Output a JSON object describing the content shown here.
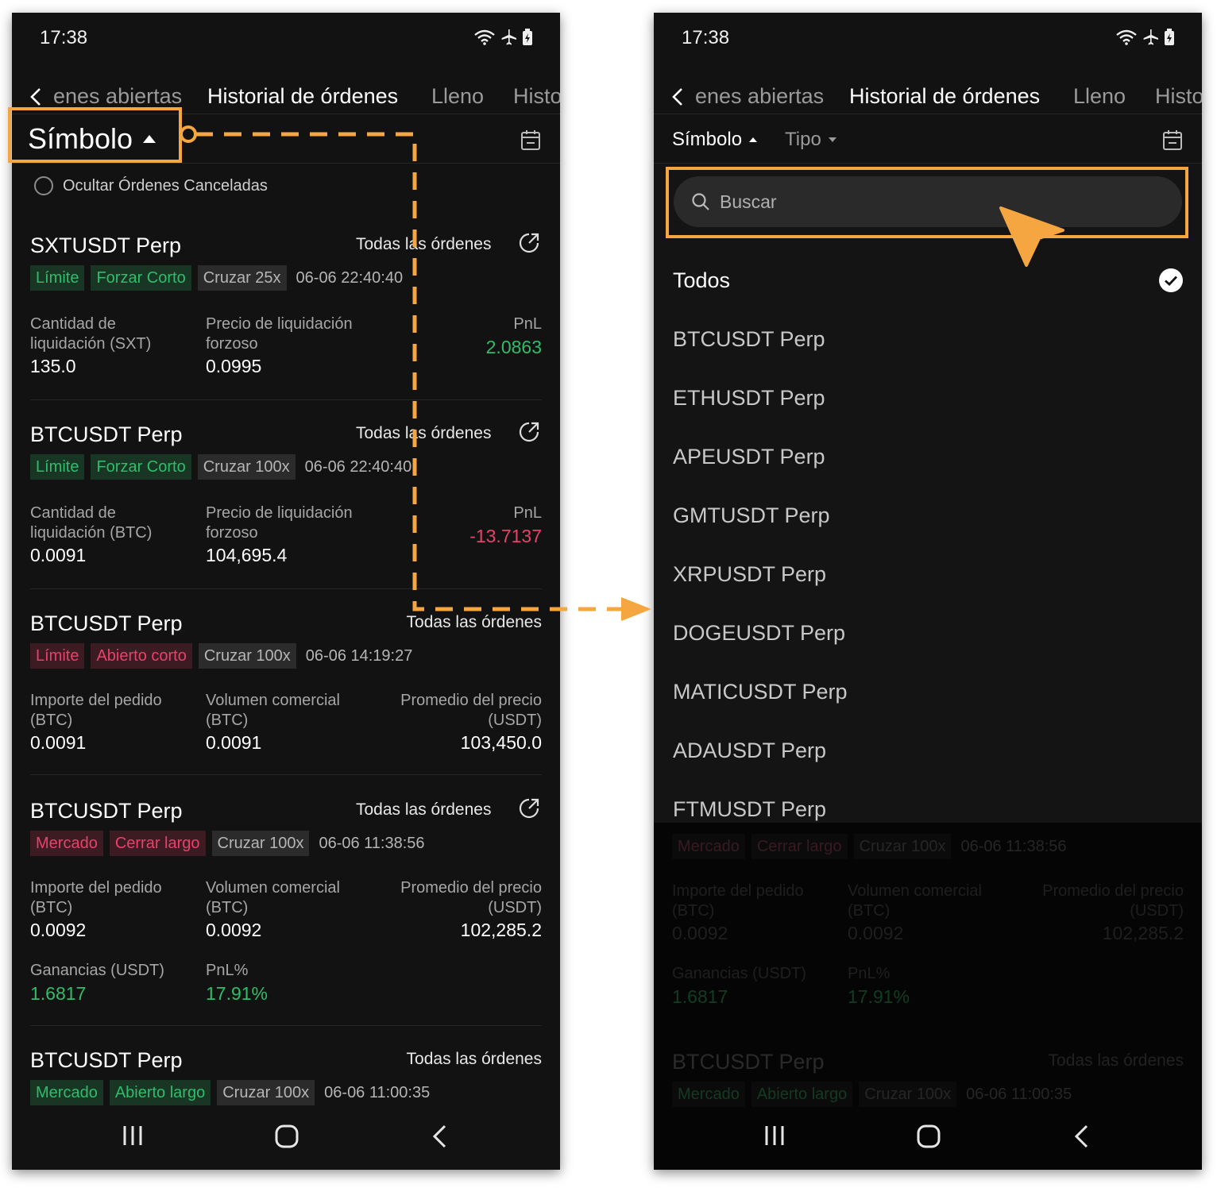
{
  "status": {
    "time": "17:38"
  },
  "tabs": [
    {
      "label": "enes abiertas"
    },
    {
      "label": "Historial de órdenes"
    },
    {
      "label": "Lleno"
    },
    {
      "label": "Histo"
    }
  ],
  "filters": {
    "symbol_label": "Símbolo",
    "type_label": "Tipo"
  },
  "hide_cancelled_label": "Ocultar Órdenes Canceladas",
  "orders": [
    {
      "symbol": "SXTUSDT Perp",
      "link": "Todas las órdenes",
      "tags": [
        "Límite",
        "Forzar Corto",
        "Cruzar 25x"
      ],
      "time": "06-06 22:40:40",
      "c1_label": "Cantidad de liquidación (SXT)",
      "c1_value": "135.0",
      "c2_label": "Precio de liquidación forzoso",
      "c2_value": "0.0995",
      "c3_label": "PnL",
      "c3_value": "2.0863"
    },
    {
      "symbol": "BTCUSDT Perp",
      "link": "Todas las órdenes",
      "tags": [
        "Límite",
        "Forzar Corto",
        "Cruzar 100x"
      ],
      "time": "06-06 22:40:40",
      "c1_label": "Cantidad de liquidación (BTC)",
      "c1_value": "0.0091",
      "c2_label": "Precio de liquidación forzoso",
      "c2_value": "104,695.4",
      "c3_label": "PnL",
      "c3_value": "-13.7137"
    },
    {
      "symbol": "BTCUSDT Perp",
      "link": "Todas las órdenes",
      "tags": [
        "Límite",
        "Abierto corto",
        "Cruzar 100x"
      ],
      "time": "06-06 14:19:27",
      "c1_label": "Importe del pedido (BTC)",
      "c1_value": "0.0091",
      "c2_label": "Volumen comercial (BTC)",
      "c2_value": "0.0091",
      "c3_label": "Promedio del precio (USDT)",
      "c3_value": "103,450.0"
    },
    {
      "symbol": "BTCUSDT Perp",
      "link": "Todas las órdenes",
      "tags": [
        "Mercado",
        "Cerrar largo",
        "Cruzar 100x"
      ],
      "time": "06-06 11:38:56",
      "c1_label": "Importe del pedido (BTC)",
      "c1_value": "0.0092",
      "c2_label": "Volumen comercial (BTC)",
      "c2_value": "0.0092",
      "c3_label": "Promedio del precio (USDT)",
      "c3_value": "102,285.2",
      "c4_label": "Ganancias (USDT)",
      "c4_value": "1.6817",
      "c5_label": "PnL%",
      "c5_value": "17.91%"
    },
    {
      "symbol": "BTCUSDT Perp",
      "link": "Todas las órdenes",
      "tags": [
        "Mercado",
        "Abierto largo",
        "Cruzar 100x"
      ],
      "time": "06-06 11:00:35"
    }
  ],
  "search": {
    "placeholder": "Buscar"
  },
  "symbol_list": [
    "Todos",
    "BTCUSDT Perp",
    "ETHUSDT Perp",
    "APEUSDT Perp",
    "GMTUSDT Perp",
    "XRPUSDT Perp",
    "DOGEUSDT Perp",
    "MATICUSDT Perp",
    "ADAUSDT Perp",
    "FTMUSDT Perp"
  ],
  "colors": {
    "accent": "#f5a640",
    "positive": "#2fbd6b",
    "negative": "#e8416b",
    "background": "#121212"
  }
}
